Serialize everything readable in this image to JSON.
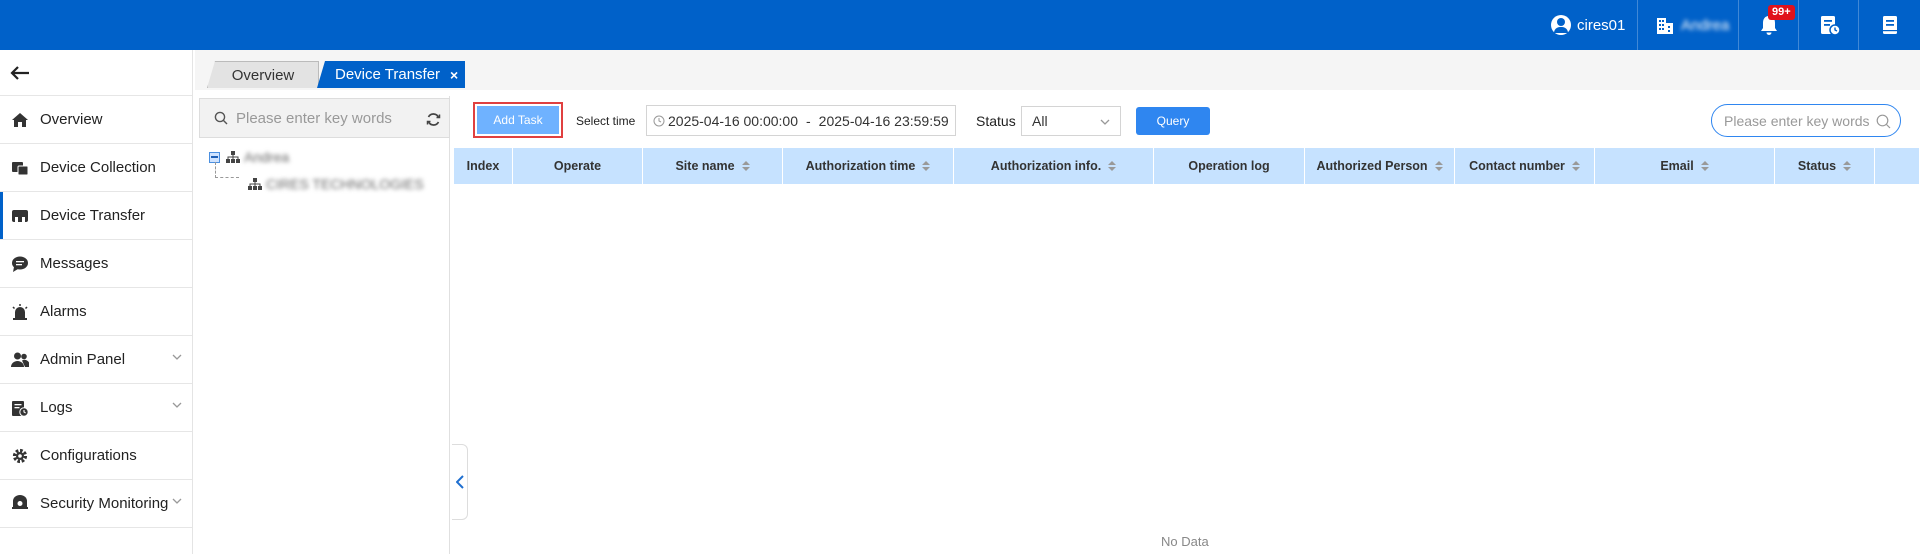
{
  "header": {
    "username": "cires01",
    "org_name": "Andrea",
    "notifications_badge": "99+",
    "colors": {
      "topbar": "#0061c9",
      "badge": "#e0121b"
    }
  },
  "sidebar": {
    "back_icon": "arrow-left-icon",
    "items": [
      {
        "label": "Overview",
        "icon": "home-icon"
      },
      {
        "label": "Device Collection",
        "icon": "device-collection-icon"
      },
      {
        "label": "Device Transfer",
        "icon": "device-transfer-icon",
        "active": true
      },
      {
        "label": "Messages",
        "icon": "message-icon"
      },
      {
        "label": "Alarms",
        "icon": "alarm-icon"
      },
      {
        "label": "Admin Panel",
        "icon": "users-icon",
        "expandable": true
      },
      {
        "label": "Logs",
        "icon": "logs-icon",
        "expandable": true
      },
      {
        "label": "Configurations",
        "icon": "gear-icon"
      },
      {
        "label": "Security Monitoring",
        "icon": "camera-icon",
        "expandable": true
      }
    ]
  },
  "tabs": [
    {
      "label": "Overview"
    },
    {
      "label": "Device Transfer",
      "active": true,
      "close": "×"
    }
  ],
  "tree": {
    "search_placeholder": "Please enter key words",
    "root": "Andrea",
    "child": "CIRES TECHNOLOGIES"
  },
  "toolbar": {
    "add_task": "Add Task",
    "select_time_label": "Select time",
    "time_start": "2025-04-16 00:00:00",
    "time_separator": "-",
    "time_end": "2025-04-16 23:59:59",
    "status_label": "Status",
    "status_value": "All",
    "query": "Query",
    "search_placeholder": "Please enter key words"
  },
  "table": {
    "columns": [
      {
        "label": "Index",
        "sortable": false
      },
      {
        "label": "Operate",
        "sortable": false
      },
      {
        "label": "Site name",
        "sortable": true
      },
      {
        "label": "Authorization time",
        "sortable": true
      },
      {
        "label": "Authorization info.",
        "sortable": true
      },
      {
        "label": "Operation log",
        "sortable": false
      },
      {
        "label": "Authorized Person",
        "sortable": true
      },
      {
        "label": "Contact number",
        "sortable": true
      },
      {
        "label": "Email",
        "sortable": true
      },
      {
        "label": "Status",
        "sortable": true
      },
      {
        "label": "",
        "sortable": false
      }
    ],
    "empty_text": "No Data"
  }
}
